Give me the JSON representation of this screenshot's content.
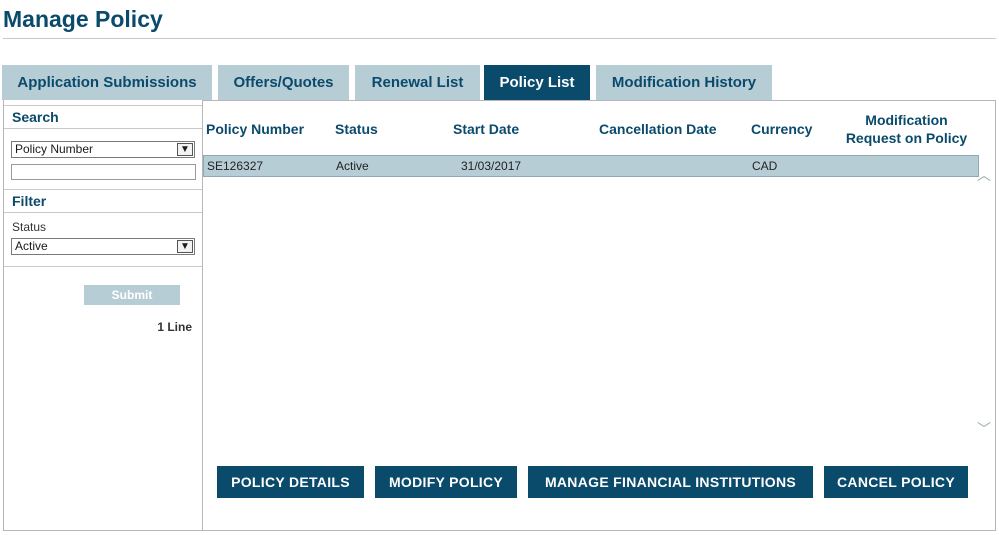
{
  "page": {
    "title": "Manage Policy"
  },
  "tabs": [
    {
      "label": "Application Submissions"
    },
    {
      "label": "Offers/Quotes"
    },
    {
      "label": "Renewal List"
    },
    {
      "label": "Policy List",
      "active": true
    },
    {
      "label": "Modification History"
    }
  ],
  "left": {
    "search_title": "Search",
    "search_select": "Policy Number",
    "search_input_value": "",
    "filter_title": "Filter",
    "status_label": "Status",
    "status_select": "Active",
    "submit_label": "Submit",
    "line_count": "1 Line"
  },
  "table": {
    "columns": [
      "Policy Number",
      "Status",
      "Start Date",
      "Cancellation Date",
      "Currency",
      "Modification Request on Policy"
    ],
    "rows": [
      {
        "policy_number": "SE126327",
        "status": "Active",
        "start_date": "31/03/2017",
        "cancellation_date": "",
        "currency": "CAD",
        "modification_request": ""
      }
    ]
  },
  "actions": {
    "policy_details": "POLICY DETAILS",
    "modify_policy": "MODIFY POLICY",
    "manage_fi": "MANAGE FINANCIAL INSTITUTIONS",
    "cancel_policy": "CANCEL POLICY"
  },
  "icons": {
    "dropdown": "chevron-down-icon",
    "scroll_up": "chevron-up-icon",
    "scroll_down": "chevron-down-icon"
  },
  "colors": {
    "brand": "#0a4a6b",
    "tab_inactive": "#b7cdd6",
    "row_selected": "#b7cdd6"
  }
}
